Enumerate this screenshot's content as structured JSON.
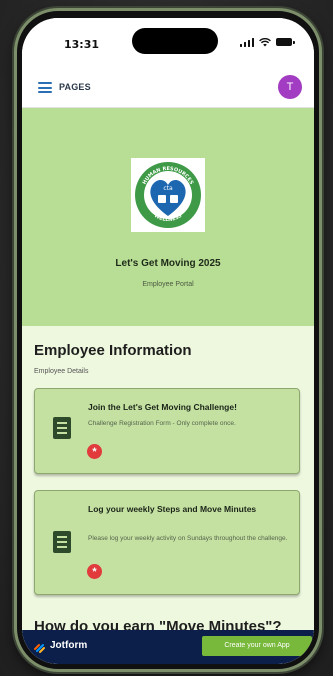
{
  "status_bar": {
    "time": "13:31"
  },
  "header": {
    "menu_label": "PAGES",
    "avatar_initial": "T"
  },
  "hero": {
    "title": "Let's Get Moving 2025",
    "subtitle": "Employee Portal",
    "logo_text_top": "HUMAN RESOURCES",
    "logo_text_bottom": "WELLNESS",
    "logo_badge": "cta"
  },
  "section": {
    "title": "Employee Information",
    "subtitle": "Employee Details"
  },
  "cards": [
    {
      "title": "Join the Let's Get Moving Challenge!",
      "description": "Challenge Registration Form - Only complete once.",
      "required": "*"
    },
    {
      "title": "Log your weekly Steps and Move Minutes",
      "description": "Please log your weekly activity on Sundays throughout the challenge.",
      "required": "*"
    }
  ],
  "section2": {
    "title": "How do you earn \"Move Minutes\"?"
  },
  "footer": {
    "brand": "Jotform",
    "create_button": "Create your own App"
  },
  "colors": {
    "hero_bg": "#b8dd94",
    "card_bg": "#c4e1a2",
    "avatar": "#a23cc2",
    "footer_bg": "#0c1f4a",
    "cta_button": "#78b83a"
  }
}
